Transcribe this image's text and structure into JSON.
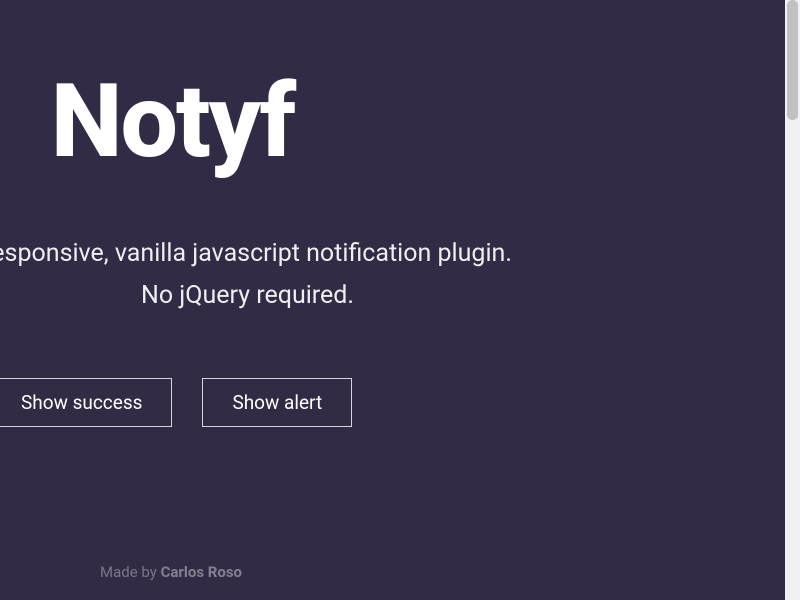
{
  "header": {
    "title": "Notyf"
  },
  "tagline": {
    "line1": "responsive, vanilla javascript notification plugin.",
    "line2": "No jQuery required."
  },
  "buttons": {
    "success_label": "Show success",
    "alert_label": "Show alert"
  },
  "footer": {
    "prefix": "Made by ",
    "author": "Carlos Roso"
  }
}
